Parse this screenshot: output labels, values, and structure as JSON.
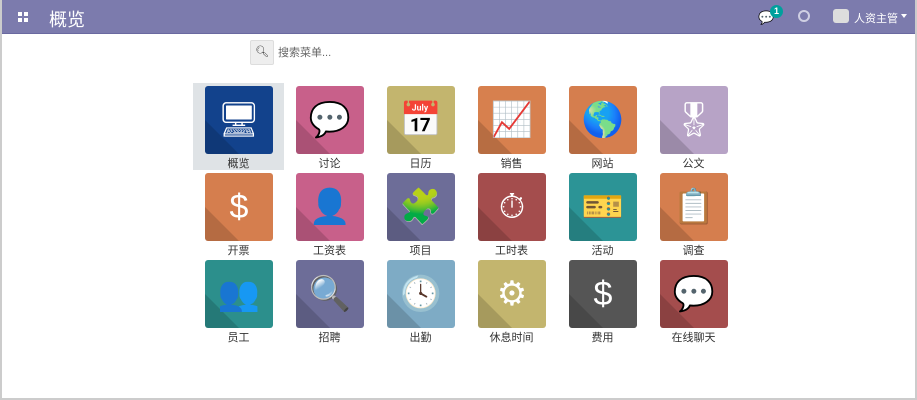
{
  "header": {
    "title": "概览",
    "chat_badge": "1",
    "user": "人资主管"
  },
  "search": {
    "placeholder": "搜索菜单..."
  },
  "apps": [
    {
      "label": "概览",
      "icon": "dashboard-icon",
      "glyph": "🖥",
      "color": "#12428c"
    },
    {
      "label": "讨论",
      "icon": "chat-icon",
      "glyph": "💬",
      "color": "#c8608a"
    },
    {
      "label": "日历",
      "icon": "calendar-icon",
      "glyph": "📅",
      "color": "#c3b56e"
    },
    {
      "label": "销售",
      "icon": "trend-icon",
      "glyph": "📈",
      "color": "#d7804e"
    },
    {
      "label": "网站",
      "icon": "globe-icon",
      "glyph": "🌎",
      "color": "#d57e4e"
    },
    {
      "label": "公文",
      "icon": "award-icon",
      "glyph": "🎖",
      "color": "#b7a3c6"
    },
    {
      "label": "开票",
      "icon": "invoice-icon",
      "glyph": "$",
      "color": "#d57e4e"
    },
    {
      "label": "工资表",
      "icon": "payroll-icon",
      "glyph": "👤",
      "color": "#c8608a"
    },
    {
      "label": "项目",
      "icon": "puzzle-icon",
      "glyph": "🧩",
      "color": "#6d6d98"
    },
    {
      "label": "工时表",
      "icon": "stopwatch-icon",
      "glyph": "⏱",
      "color": "#a44d4d"
    },
    {
      "label": "活动",
      "icon": "ticket-icon",
      "glyph": "🎫",
      "color": "#2c9496"
    },
    {
      "label": "调查",
      "icon": "survey-icon",
      "glyph": "📋",
      "color": "#d57e4e"
    },
    {
      "label": "员工",
      "icon": "employees-icon",
      "glyph": "👥",
      "color": "#2c8f8c"
    },
    {
      "label": "招聘",
      "icon": "recruit-search-icon",
      "glyph": "🔍",
      "color": "#6d6d98"
    },
    {
      "label": "出勤",
      "icon": "attendance-icon",
      "glyph": "🕓",
      "color": "#7eabc5"
    },
    {
      "label": "休息时间",
      "icon": "leave-icon",
      "glyph": "⚙",
      "color": "#c3b56e"
    },
    {
      "label": "费用",
      "icon": "expense-icon",
      "glyph": "$",
      "color": "#555555"
    },
    {
      "label": "在线聊天",
      "icon": "livechat-icon",
      "glyph": "💬",
      "color": "#a44d4d"
    }
  ]
}
